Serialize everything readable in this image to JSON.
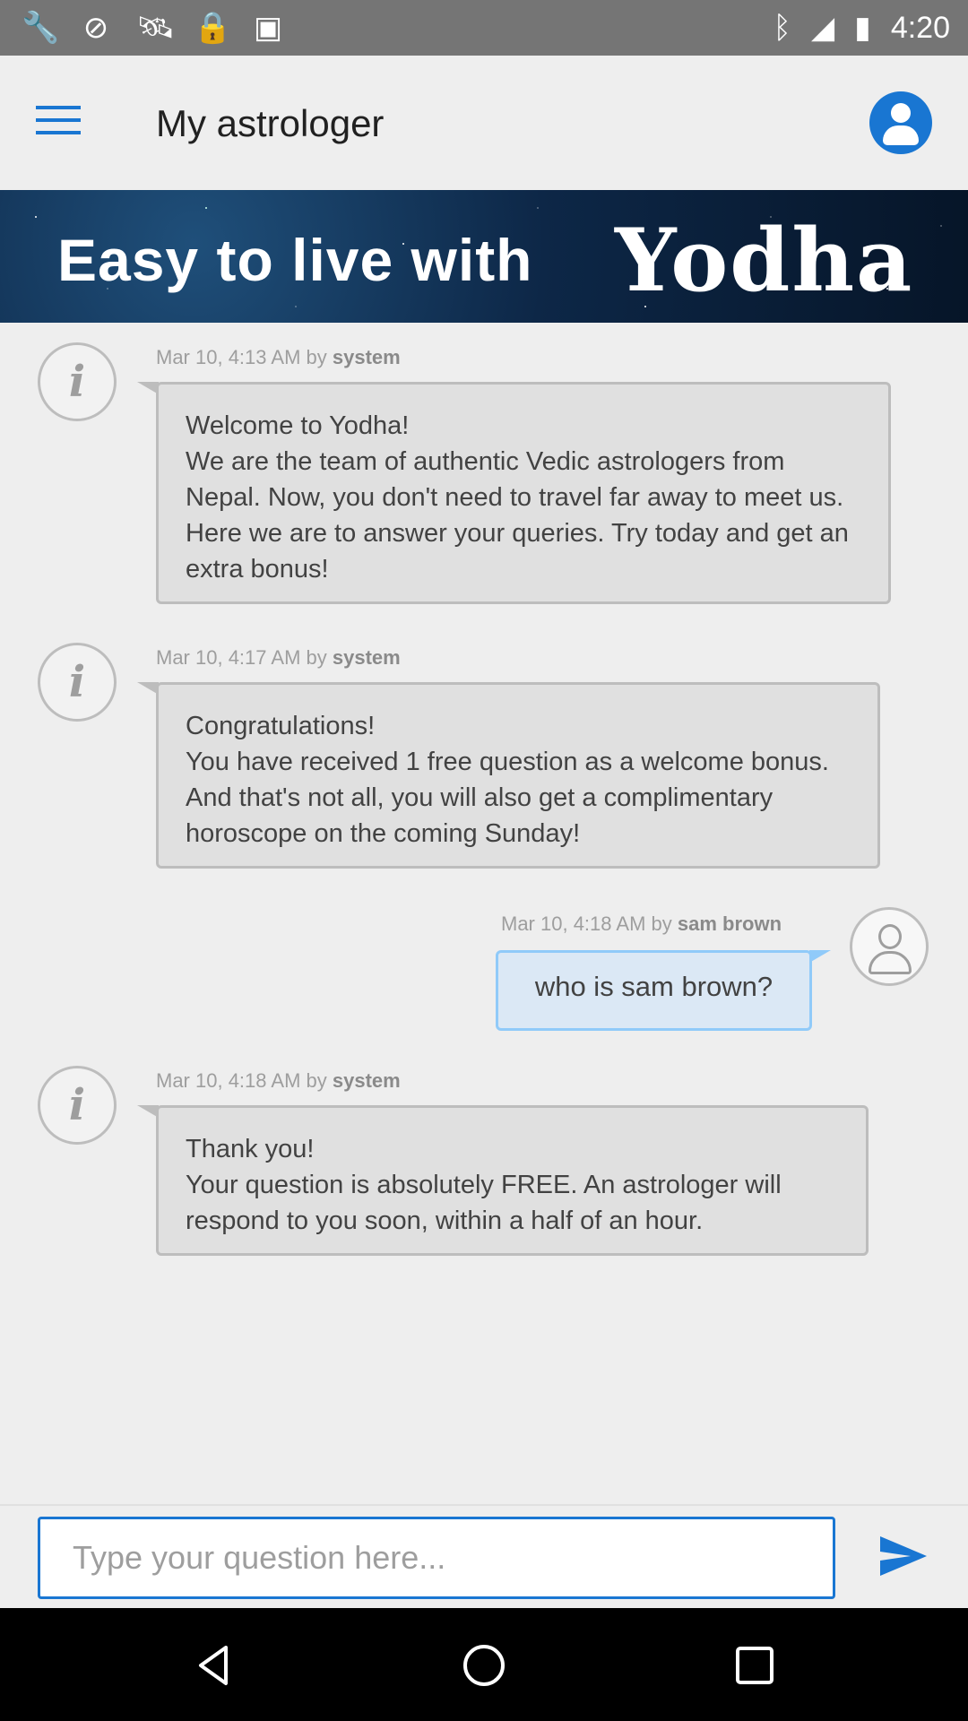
{
  "status_bar": {
    "left_icons": [
      "wrench-icon",
      "circle-slash-icon",
      "satellite-icon",
      "lock-icon",
      "android-icon"
    ],
    "right_icons": [
      "bluetooth-icon",
      "signal-icon",
      "battery-icon"
    ],
    "time": "4:20"
  },
  "app_bar": {
    "title": "My astrologer",
    "menu_icon": "menu-icon",
    "profile_icon": "account-icon"
  },
  "banner": {
    "text": "Easy to live with",
    "brand": "Yodha"
  },
  "messages": [
    {
      "type": "system",
      "meta_time": "Mar 10, 4:13 AM by ",
      "meta_author": "system",
      "text": "Welcome to Yodha!\nWe are the team of authentic Vedic astrologers from Nepal. Now, you don't need to travel far away to meet us. Here we are to answer your queries. Try today and get an extra bonus!"
    },
    {
      "type": "system",
      "meta_time": "Mar 10, 4:17 AM by ",
      "meta_author": "system",
      "text": "Congratulations!\nYou have received 1 free question as a welcome bonus. And that's not all, you will also get a complimentary horoscope on the coming Sunday!"
    },
    {
      "type": "user",
      "meta_time": "Mar 10, 4:18 AM by ",
      "meta_author": "sam brown",
      "text": "who is sam brown?"
    },
    {
      "type": "system",
      "meta_time": "Mar 10, 4:18 AM by ",
      "meta_author": "system",
      "text": "Thank you!\nYour question is absolutely FREE. An astrologer will respond to you soon, within a half of an hour."
    }
  ],
  "input": {
    "placeholder": "Type your question here...",
    "value": ""
  },
  "colors": {
    "accent": "#1976d2",
    "system_bubble": "#e0e0e0",
    "user_bubble": "#dbe8f5"
  }
}
